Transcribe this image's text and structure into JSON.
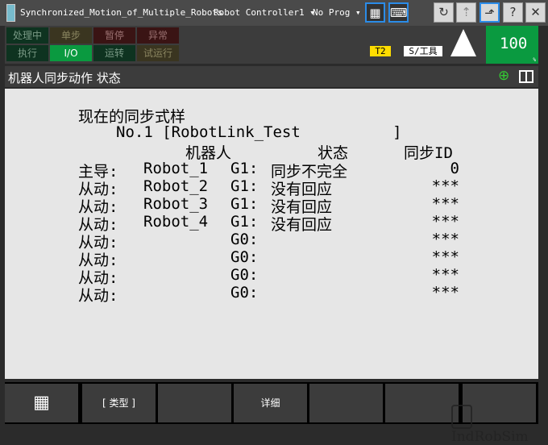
{
  "titlebar": {
    "title": "Synchronized_Motion_of_Multiple_Robots",
    "controller": "Robot Controller1",
    "program": "No Prog"
  },
  "status_leds": [
    {
      "label": "处理中",
      "bg": "#0e3320",
      "fg": "#7a9a86"
    },
    {
      "label": "单步",
      "bg": "#3a3520",
      "fg": "#8a8560"
    },
    {
      "label": "暂停",
      "bg": "#3a1414",
      "fg": "#9a7070"
    },
    {
      "label": "异常",
      "bg": "#3a1414",
      "fg": "#9a7070"
    },
    {
      "label": "执行",
      "bg": "#0e3320",
      "fg": "#7a9a86"
    },
    {
      "label": "I/O",
      "bg": "#0a9a40",
      "fg": "#ffffff"
    },
    {
      "label": "运转",
      "bg": "#0e3320",
      "fg": "#7a9a86"
    },
    {
      "label": "试运行",
      "bg": "#3a3520",
      "fg": "#8a8560"
    }
  ],
  "mode": "T2",
  "frame": "S/工具",
  "override": "100",
  "override_unit": "%",
  "header": {
    "title": "机器人同步动作 状态"
  },
  "content": {
    "heading": "现在的同步式样",
    "pattern": "No.1 [RobotLink_Test          ]",
    "col_robot": "机器人",
    "col_status": "状态",
    "col_id": "同步ID",
    "rows": [
      {
        "role": "主导:",
        "robot": "Robot_1",
        "group": "G1:",
        "status": "同步不完全",
        "id": "0"
      },
      {
        "role": "从动:",
        "robot": "Robot_2",
        "group": "G1:",
        "status": "没有回应",
        "id": "***"
      },
      {
        "role": "从动:",
        "robot": "Robot_3",
        "group": "G1:",
        "status": "没有回应",
        "id": "***"
      },
      {
        "role": "从动:",
        "robot": "Robot_4",
        "group": "G1:",
        "status": "没有回应",
        "id": "***"
      },
      {
        "role": "从动:",
        "robot": "",
        "group": "G0:",
        "status": "",
        "id": "***"
      },
      {
        "role": "从动:",
        "robot": "",
        "group": "G0:",
        "status": "",
        "id": "***"
      },
      {
        "role": "从动:",
        "robot": "",
        "group": "G0:",
        "status": "",
        "id": "***"
      },
      {
        "role": "从动:",
        "robot": "",
        "group": "G0:",
        "status": "",
        "id": "***"
      }
    ]
  },
  "fkeys": [
    "",
    "[ 类型 ]",
    "",
    "详细",
    "",
    "",
    ""
  ],
  "watermark": "IndRobSim"
}
